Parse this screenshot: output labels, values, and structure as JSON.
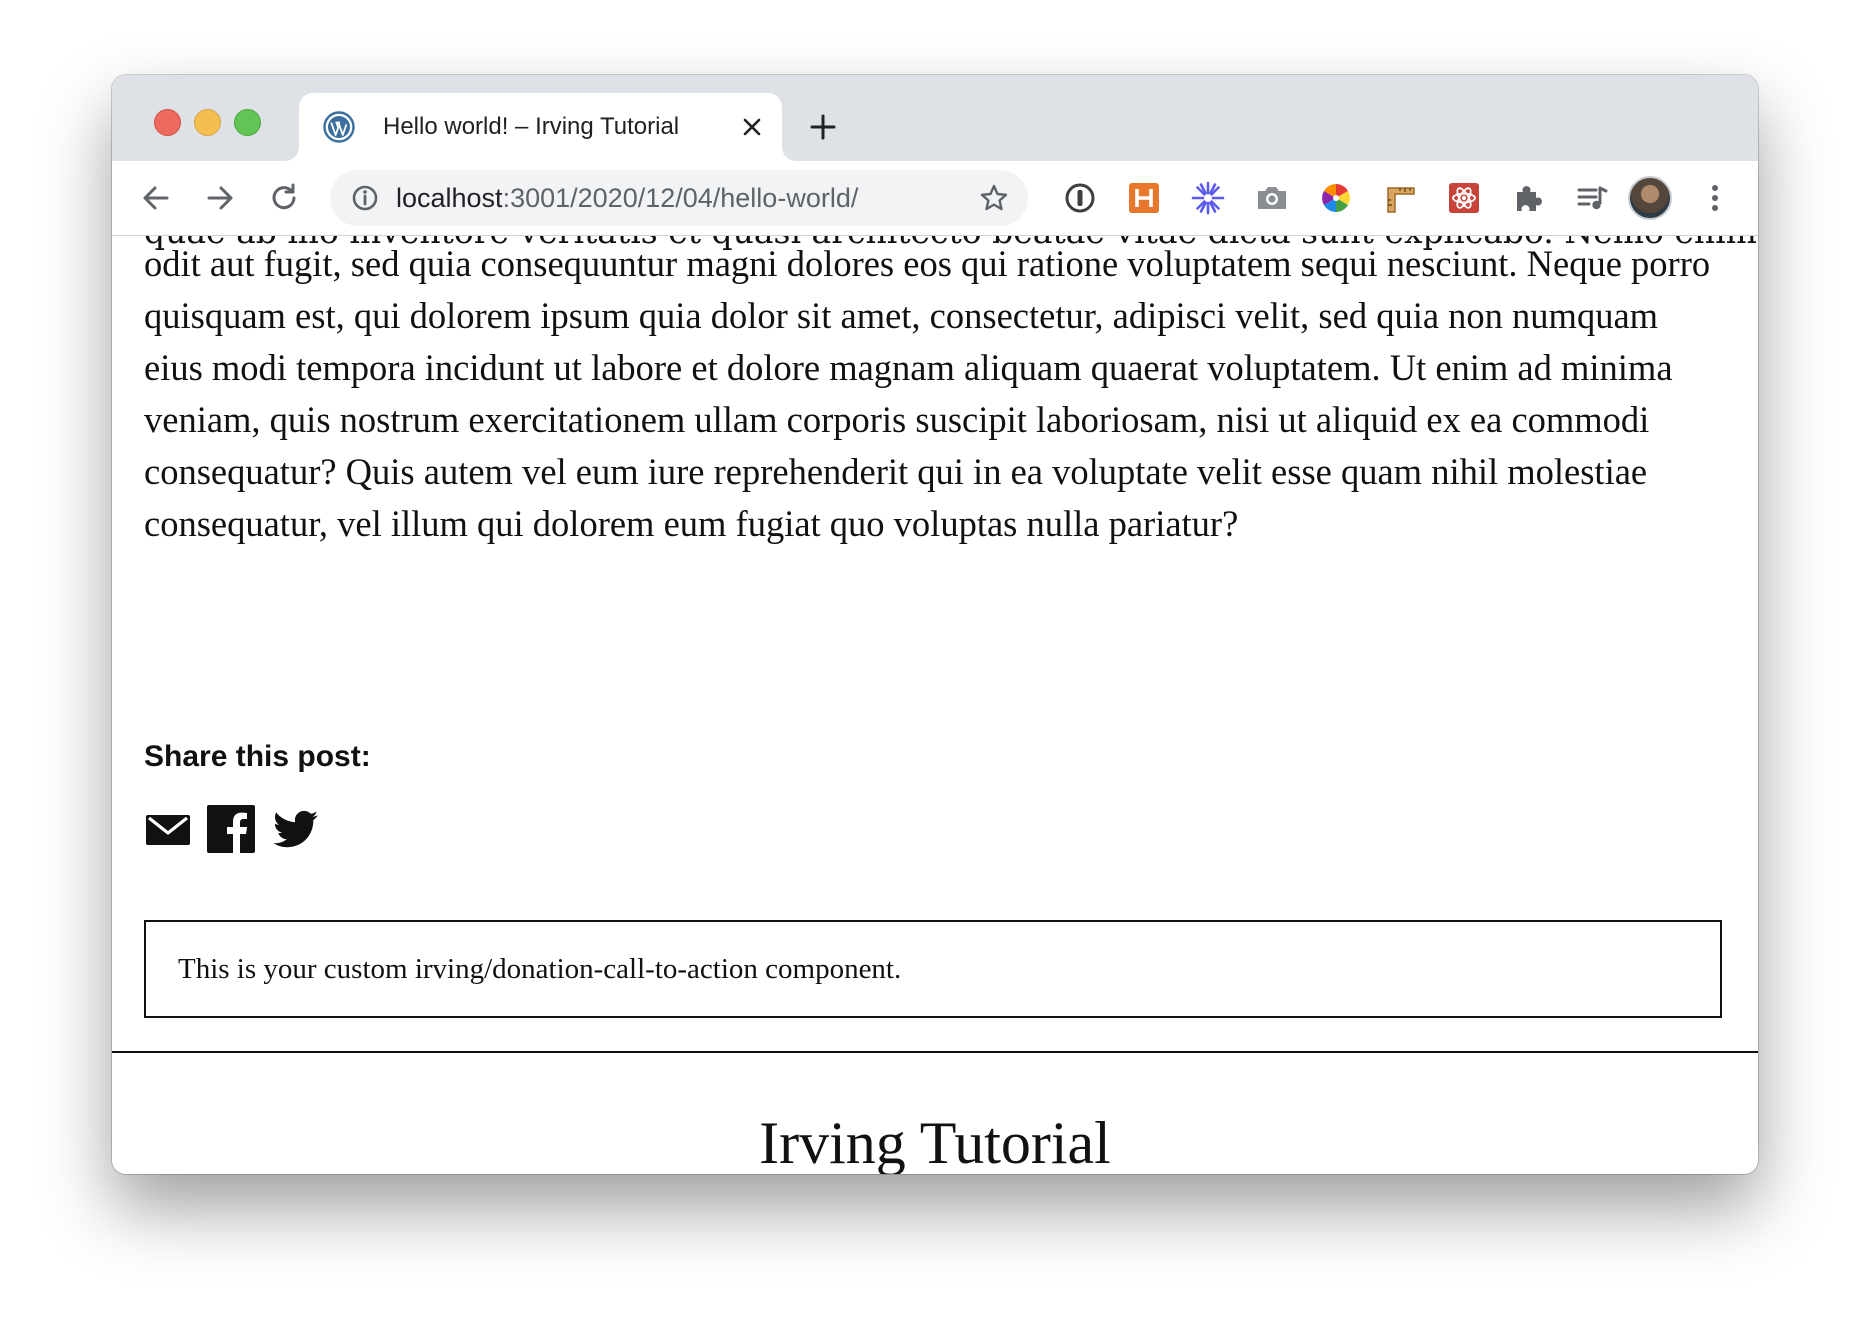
{
  "browser": {
    "tab": {
      "title": "Hello world! – Irving Tutorial",
      "favicon": "wordpress-icon"
    },
    "new_tab_icon": "plus-icon",
    "address": {
      "host": "localhost",
      "path": ":3001/2020/12/04/hello-world/"
    },
    "extensions": [
      "1password-icon",
      "h-extension-icon",
      "sparkle-extension-icon",
      "camera-icon",
      "color-wheel-icon",
      "ruler-icon",
      "react-devtools-icon",
      "puzzle-icon",
      "media-queue-icon"
    ]
  },
  "article": {
    "cut_line": "quae ab illo inventore veritatis et quasi architecto beatae vitae dicta sunt explicabo. Nemo enim",
    "body": "odit aut fugit, sed quia consequuntur magni dolores eos qui ratione voluptatem sequi nesciunt. Neque porro quisquam est, qui dolorem ipsum quia dolor sit amet, consectetur, adipisci velit, sed quia non numquam eius modi tempora incidunt ut labore et dolore magnam aliquam quaerat voluptatem. Ut enim ad minima veniam, quis nostrum exercitationem ullam corporis suscipit laboriosam, nisi ut aliquid ex ea commodi consequatur? Quis autem vel eum iure reprehenderit qui in ea voluptate velit esse quam nihil molestiae consequatur, vel illum qui dolorem eum fugiat quo voluptas nulla pariatur?"
  },
  "share": {
    "heading": "Share this post:",
    "icons": [
      "email-icon",
      "facebook-icon",
      "twitter-icon"
    ]
  },
  "cta": {
    "text": "This is your custom irving/donation-call-to-action component."
  },
  "footer": {
    "site_title": "Irving Tutorial"
  },
  "colors": {
    "tabstrip": "#dee1e6",
    "omnibox": "#f1f3f4",
    "text": "#111111"
  }
}
